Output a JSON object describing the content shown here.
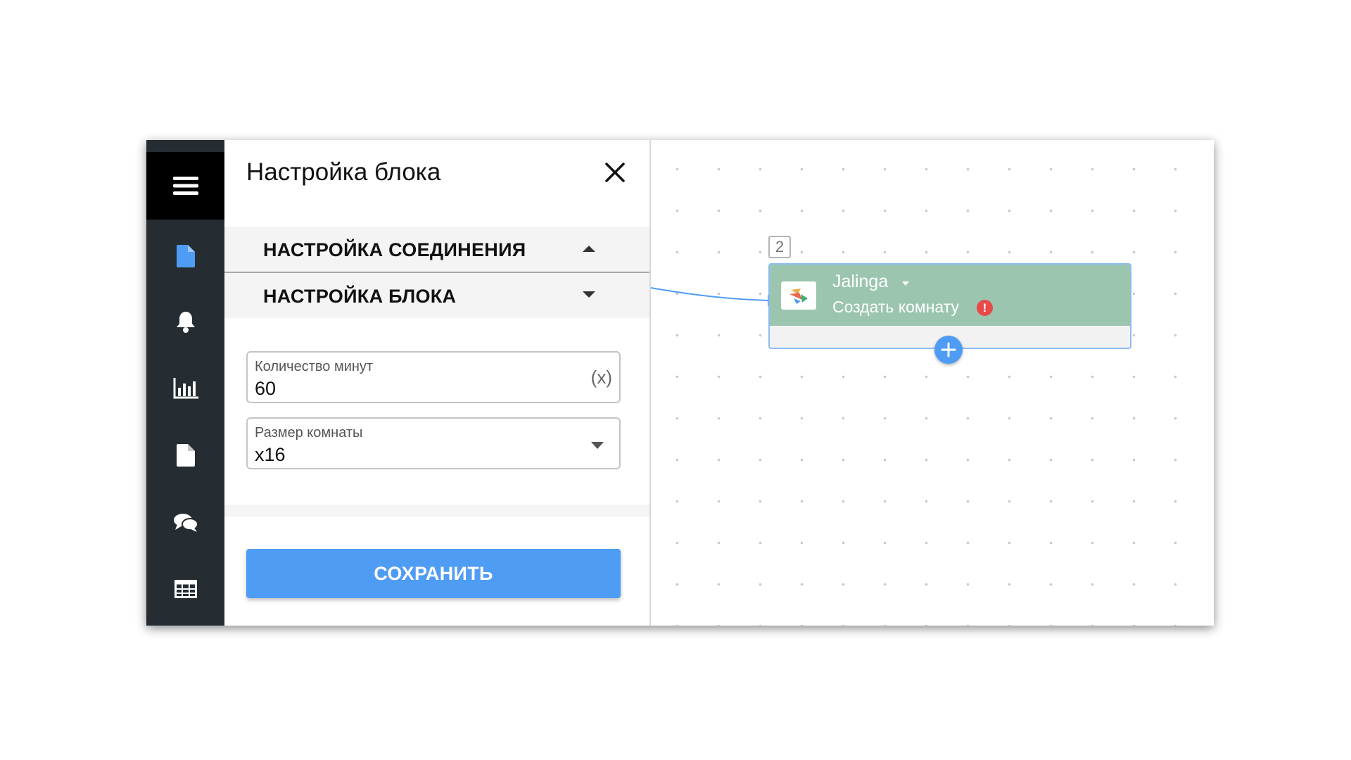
{
  "panel": {
    "title": "Настройка блока",
    "sections": [
      {
        "label": "НАСТРОЙКА СОЕДИНЕНИЯ",
        "expanded": false
      },
      {
        "label": "НАСТРОЙКА БЛОКА",
        "expanded": true
      }
    ],
    "fields": [
      {
        "label": "Количество минут",
        "value": "60",
        "suffix": "(x)"
      },
      {
        "label": "Размер комнаты",
        "value": "x16"
      }
    ],
    "save_label": "СОХРАНИТЬ"
  },
  "nav": {
    "icons": [
      "menu-icon",
      "document-icon",
      "bell-icon",
      "bar-chart-icon",
      "file-icon",
      "chat-icon",
      "table-icon"
    ],
    "active_color": "#4f9cf5"
  },
  "canvas": {
    "block_number": "2",
    "block": {
      "app_name": "Jalinga",
      "action": "Создать комнату",
      "warning": "!",
      "header_color": "#9bc5af"
    }
  },
  "colors": {
    "accent": "#4f9cf5",
    "nav_bg": "#252d33",
    "warning": "#e84a4a"
  }
}
